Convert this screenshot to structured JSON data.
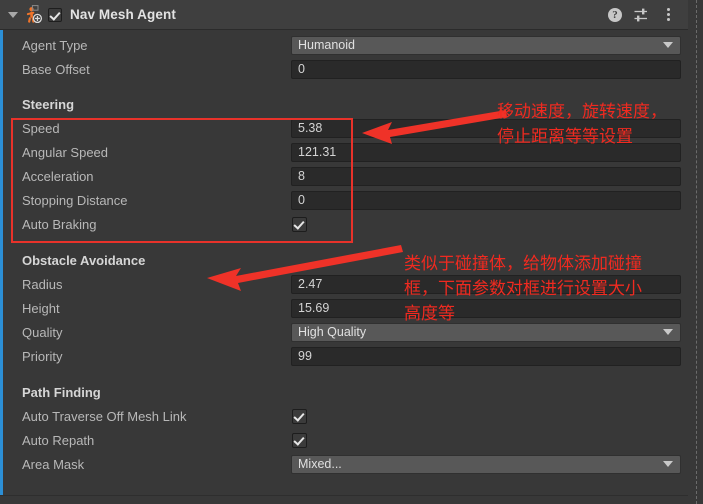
{
  "component": {
    "title": "Nav Mesh Agent",
    "enabled_checkbox": "checked",
    "foldout": "expanded",
    "icon_name": "nav-mesh-agent-icon",
    "header_icons": [
      {
        "name": "help-icon",
        "glyph": "?"
      },
      {
        "name": "preset-icon",
        "glyph": ""
      },
      {
        "name": "more-menu-icon",
        "glyph": ""
      }
    ]
  },
  "properties": {
    "agent_type": {
      "label": "Agent Type",
      "value": "Humanoid",
      "control": "dropdown"
    },
    "base_offset": {
      "label": "Base Offset",
      "value": "0",
      "control": "text"
    }
  },
  "steering": {
    "header": "Steering",
    "rows": [
      {
        "label": "Speed",
        "value": "5.38",
        "control": "text"
      },
      {
        "label": "Angular Speed",
        "value": "121.31",
        "control": "text"
      },
      {
        "label": "Acceleration",
        "value": "8",
        "control": "text"
      },
      {
        "label": "Stopping Distance",
        "value": "0",
        "control": "text"
      },
      {
        "label": "Auto Braking",
        "value": "checked",
        "control": "checkbox"
      }
    ]
  },
  "obstacle_avoidance": {
    "header": "Obstacle Avoidance",
    "rows": [
      {
        "label": "Radius",
        "value": "2.47",
        "control": "text"
      },
      {
        "label": "Height",
        "value": "15.69",
        "control": "text"
      },
      {
        "label": "Quality",
        "value": "High Quality",
        "control": "dropdown"
      },
      {
        "label": "Priority",
        "value": "99",
        "control": "text"
      }
    ]
  },
  "path_finding": {
    "header": "Path Finding",
    "rows": [
      {
        "label": "Auto Traverse Off Mesh Link",
        "value": "checked",
        "control": "checkbox"
      },
      {
        "label": "Auto Repath",
        "value": "checked",
        "control": "checkbox"
      },
      {
        "label": "Area Mask",
        "value": "Mixed...",
        "control": "dropdown"
      }
    ]
  },
  "annotations": {
    "color": "#f02a20",
    "note_1": {
      "line_1": "移动速度，旋转速度，",
      "line_2": "停止距离等等设置"
    },
    "note_2": {
      "line_1": "类似于碰撞体，给物体添加碰撞",
      "line_2": "框，下面参数对框进行设置大小",
      "line_3": "高度等"
    }
  },
  "theme": {
    "background": "#383838",
    "header_background": "#3f3f3f",
    "text_field_background": "#2a2a2a",
    "dropdown_background": "#585858",
    "label_color": "#b8b8b8",
    "accent_color": "#2c8fd6"
  }
}
